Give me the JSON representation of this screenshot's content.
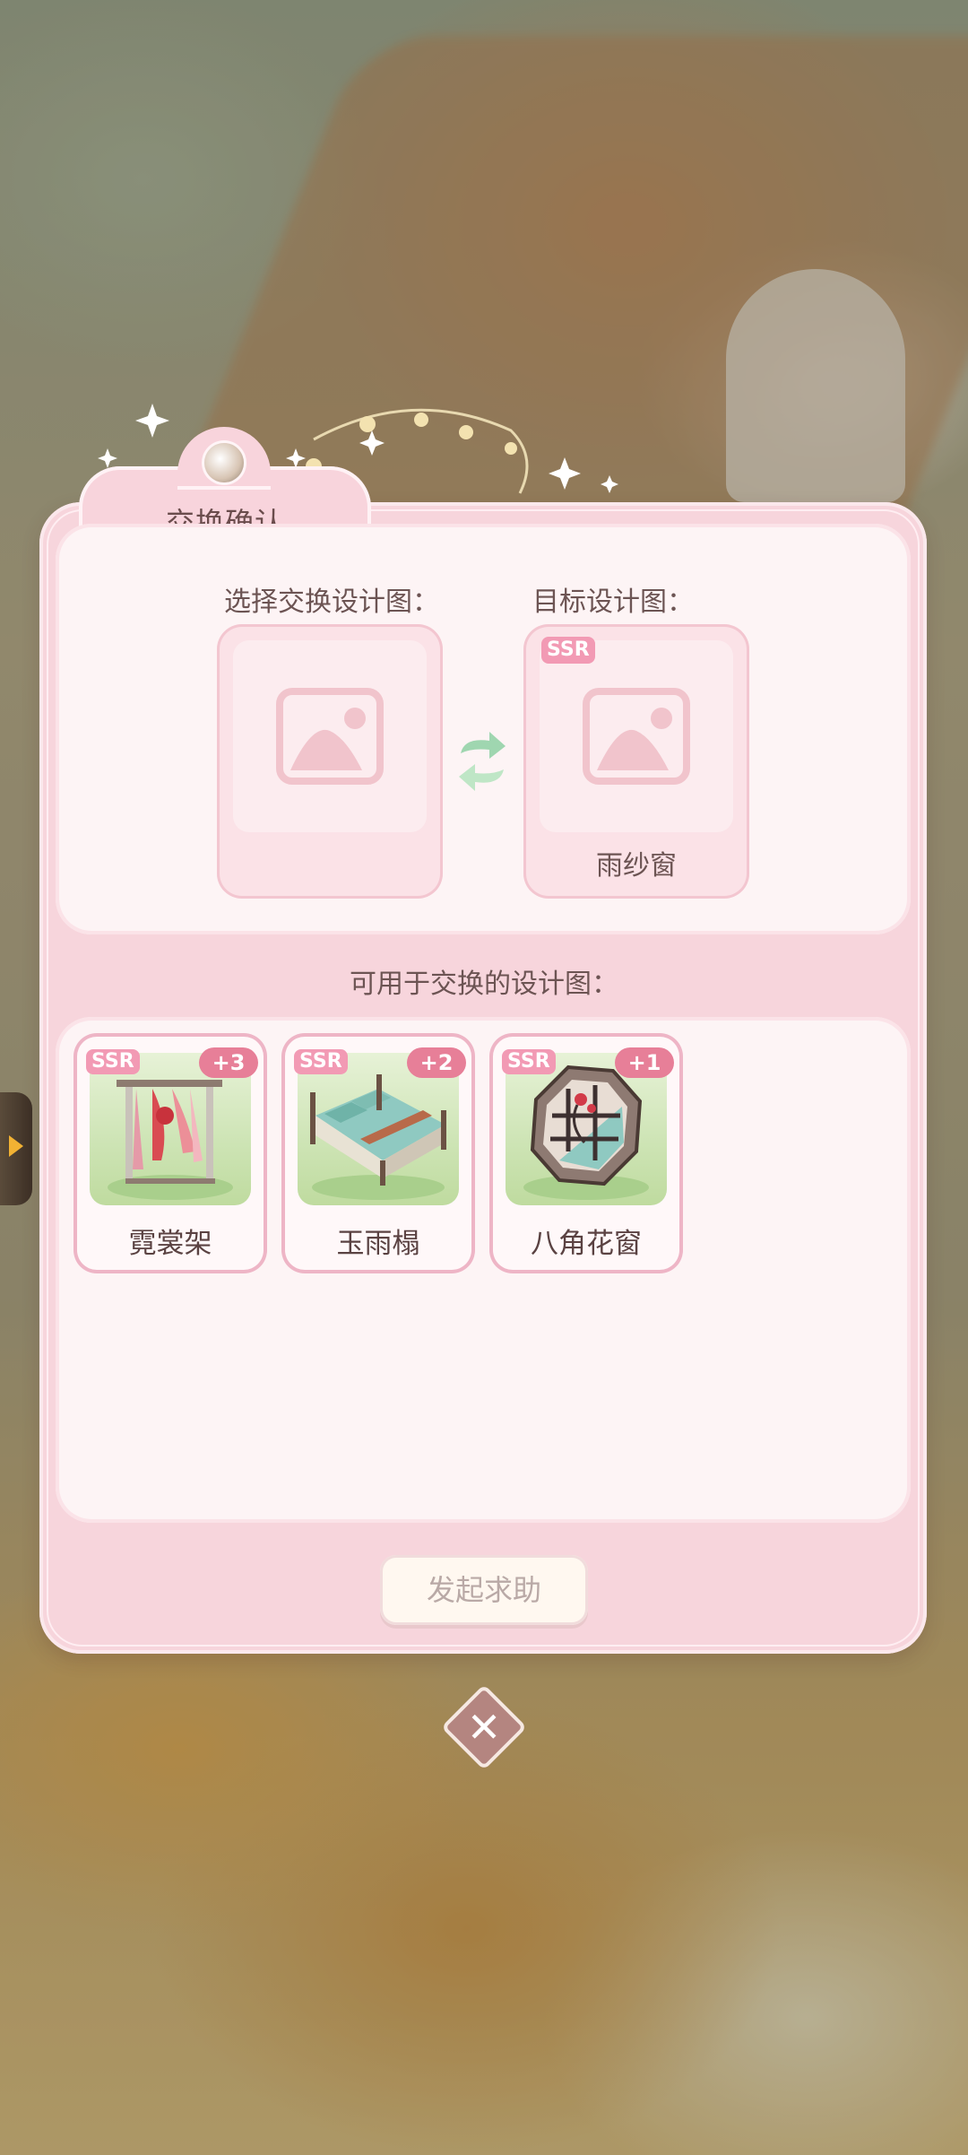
{
  "dialog": {
    "title": "交换确认",
    "select_label": "选择交换设计图：",
    "target_label": "目标设计图：",
    "available_label": "可用于交换的设计图：",
    "help_button": "发起求助"
  },
  "target": {
    "rarity": "SSR",
    "name": "雨纱窗"
  },
  "items": [
    {
      "rarity": "SSR",
      "count": "+3",
      "name": "霓裳架"
    },
    {
      "rarity": "SSR",
      "count": "+2",
      "name": "玉雨榻"
    },
    {
      "rarity": "SSR",
      "count": "+1",
      "name": "八角花窗"
    }
  ],
  "colors": {
    "accent_pink": "#f29ab4",
    "badge": "#e77f98",
    "panel": "#f7d5dc"
  }
}
